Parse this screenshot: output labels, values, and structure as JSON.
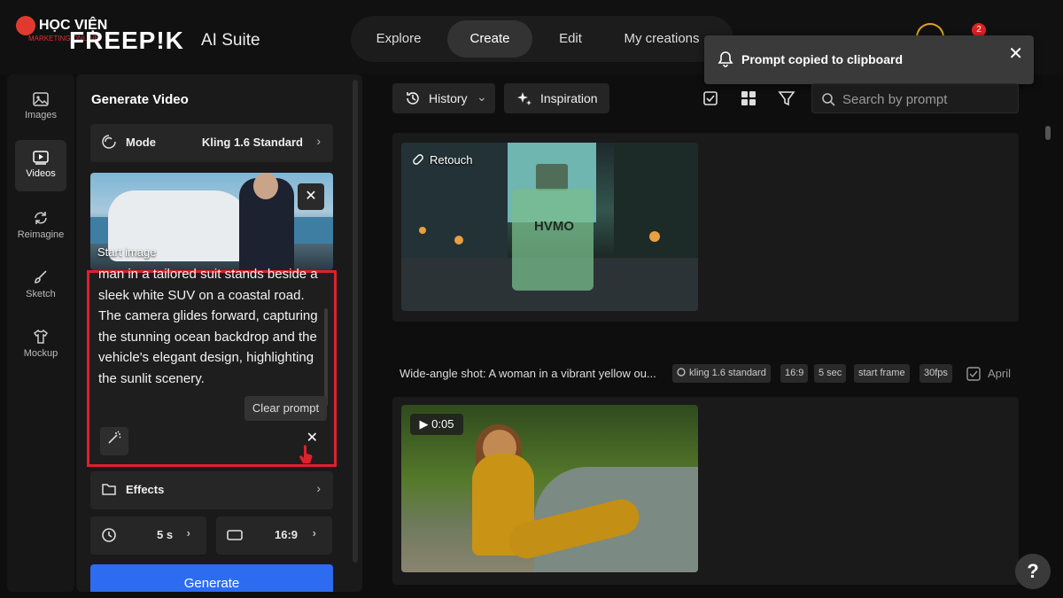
{
  "header": {
    "watermark_title": "HỌC VIỆN",
    "watermark_sub": "MARKETING ONLINE",
    "brand": "FREEP!K",
    "suite": "AI Suite",
    "nav_tabs": [
      {
        "label": "Explore"
      },
      {
        "label": "Create",
        "active": true
      },
      {
        "label": "Edit"
      },
      {
        "label": "My creations"
      }
    ],
    "notification_count": "2"
  },
  "toast": {
    "message": "Prompt copied to clipboard",
    "close": "✕"
  },
  "sidebar": {
    "items": [
      {
        "label": "Images",
        "icon": "image-icon"
      },
      {
        "label": "Videos",
        "icon": "video-icon",
        "active": true
      },
      {
        "label": "Reimagine",
        "icon": "refresh-icon"
      },
      {
        "label": "Sketch",
        "icon": "brush-icon"
      },
      {
        "label": "Mockup",
        "icon": "shirt-icon"
      }
    ]
  },
  "panel": {
    "title": "Generate Video",
    "mode_label": "Mode",
    "mode_value": "Kling 1.6 Standard",
    "start_image_caption": "Start image",
    "prompt_text": "man in a tailored suit stands beside a sleek white SUV on a coastal road. The camera glides forward, capturing the stunning ocean backdrop and the vehicle's elegant design, highlighting the sunlit scenery.",
    "clear_tooltip": "Clear prompt",
    "effects_label": "Effects",
    "duration_value": "5 s",
    "ratio_value": "16:9",
    "generate_label": "Generate"
  },
  "toolbar": {
    "history_label": "History",
    "inspiration_label": "Inspiration",
    "search_placeholder": "Search by prompt"
  },
  "results": {
    "card1": {
      "retouch_label": "Retouch",
      "bottle_text": "HVMO"
    },
    "card2": {
      "description": "Wide-angle shot: A woman in a vibrant yellow ou...",
      "tags": [
        "kling 1.6 standard",
        "16:9",
        "5 sec",
        "start frame",
        "30fps"
      ],
      "date": "April",
      "duration": "▶ 0:05"
    }
  },
  "help_label": "?",
  "colors": {
    "accent": "#2d6cf0",
    "highlight": "#e0202a",
    "notification": "#d22"
  }
}
